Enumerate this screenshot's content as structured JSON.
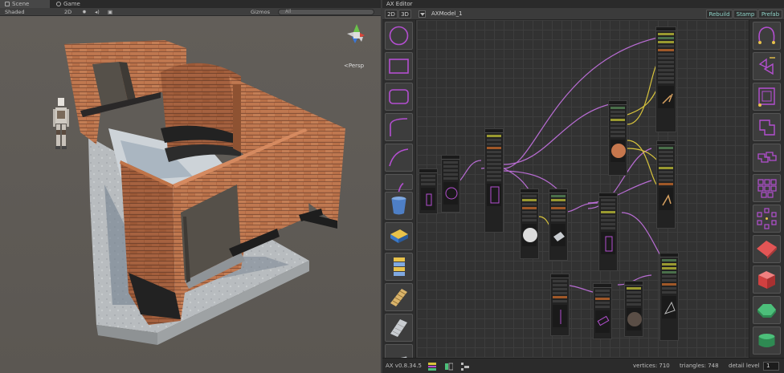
{
  "scene_window": {
    "tabs": [
      {
        "label": "Scene"
      },
      {
        "label": "Game"
      }
    ],
    "toolbar": {
      "shading": "Shaded",
      "mode_2d": "2D",
      "gizmos": "Gizmos",
      "search_placeholder": "All"
    },
    "persp_label": "Persp",
    "icons": [
      "sun-icon",
      "speaker-icon",
      "image-icon",
      "gizmo-icon",
      "robot-figure"
    ]
  },
  "ax_editor": {
    "title": "AX Editor",
    "toolbar": {
      "btn_2d": "2D",
      "btn_3d": "3D",
      "model_name": "AXModel_1",
      "rebuild": "Rebuild",
      "stamp": "Stamp",
      "prefab": "Prefab"
    },
    "left_palette": [
      "circle-shape",
      "rectangle-shape",
      "rounded-rectangle-shape",
      "curve-shape",
      "arc-shape",
      "partial-shape",
      "cylinder-mesh",
      "block-mesh",
      "stack-mesh",
      "stair-mesh",
      "ramp-mesh"
    ],
    "right_palette": [
      "path-tool",
      "merge-tool",
      "offset-tool",
      "shape-tool",
      "shape-dup-tool",
      "grid-repeater",
      "radial-repeater",
      "plane-mesh",
      "box-mesh",
      "hex-mesh",
      "pill-mesh"
    ],
    "status": {
      "version": "AX v0.8.34.5",
      "vertices": "vertices: 710",
      "triangles": "triangles: 748",
      "detail_label": "detail level",
      "detail_value": "1"
    },
    "colors": {
      "accent_purple": "#b44fd1",
      "connection_yellow": "#d8c43c",
      "connection_purple": "#b86cd3",
      "teal_text": "#8fd3c8"
    }
  }
}
